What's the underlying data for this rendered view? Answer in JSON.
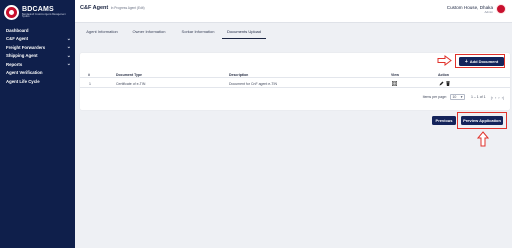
{
  "brand": {
    "name": "BDCAMS",
    "subtitle": "Bangladesh Customs Agents Management System"
  },
  "sidebar": {
    "items": [
      {
        "label": "Dashboard",
        "chevron": false
      },
      {
        "label": "C&F Agent",
        "chevron": true
      },
      {
        "label": "Freight Forwarders",
        "chevron": true
      },
      {
        "label": "Shipping Agent",
        "chevron": true
      },
      {
        "label": "Reports",
        "chevron": true
      },
      {
        "label": "Agent Verification",
        "chevron": false
      },
      {
        "label": "Agent Life Cycle",
        "chevron": false
      }
    ]
  },
  "header": {
    "title": "C&F Agent",
    "subtitle": "In Progress Agent (Edit)",
    "user_name": "Custom House, Dhaka",
    "user_role": "Admin"
  },
  "tabs": [
    {
      "label": "Agent Information",
      "active": false
    },
    {
      "label": "Owner Information",
      "active": false
    },
    {
      "label": "Sorkar Information",
      "active": false
    },
    {
      "label": "Documents Upload",
      "active": true
    }
  ],
  "card": {
    "add_button": "Add Document",
    "columns": [
      "#",
      "Document Type",
      "Description",
      "View",
      "Action"
    ],
    "rows": [
      {
        "num": "1",
        "type": "Certificate of e-TIN",
        "description": "Document for CnF agent e-TIN"
      }
    ],
    "pagination": {
      "label": "Items per page:",
      "per_page": "10",
      "range": "1 – 1 of 1"
    }
  },
  "footer": {
    "previous_button": "Previous",
    "preview_button": "Preview Application"
  },
  "colors": {
    "sidebar": "#0f1f4b",
    "primary_button": "#13235a",
    "annotation": "#e0322b"
  }
}
